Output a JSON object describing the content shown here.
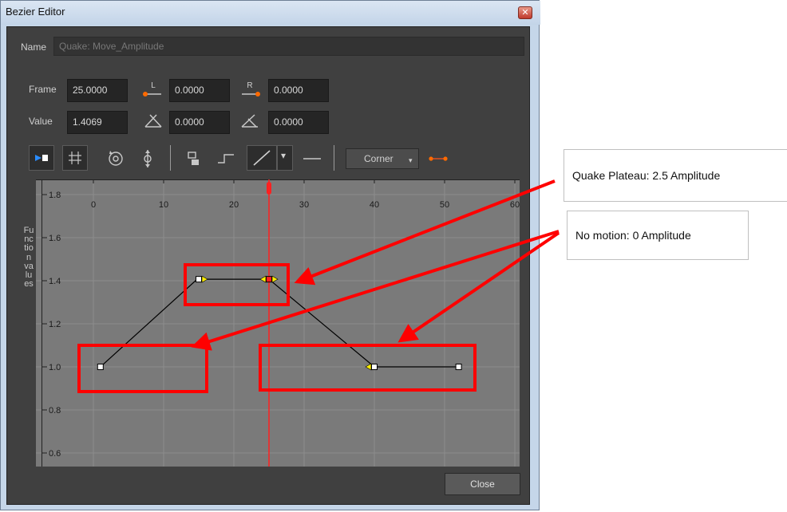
{
  "window": {
    "title": "Bezier Editor",
    "close_glyph": "✕"
  },
  "name_row": {
    "label": "Name",
    "value": "Quake: Move_Amplitude"
  },
  "fields": {
    "frame_label": "Frame",
    "frame_value": "25.0000",
    "left_x_value": "0.0000",
    "right_x_value": "0.0000",
    "value_label": "Value",
    "value_value": "1.4069",
    "left_angle_value": "0.0000",
    "right_angle_value": "0.0000",
    "left_handle_letter": "L",
    "right_handle_letter": "R"
  },
  "toolbar": {
    "interpolation_button": "Corner",
    "dropdown_arrow": "▾"
  },
  "graph": {
    "axis_title": "Function values",
    "x_ticks": [
      "0",
      "10",
      "20",
      "30",
      "40",
      "50",
      "60"
    ],
    "y_ticks": [
      "1.8",
      "1.6",
      "1.4",
      "1.2",
      "1.0",
      "0.8",
      "0.6"
    ],
    "current_frame": 25,
    "keyframes": [
      {
        "frame": 1,
        "value": 1.0
      },
      {
        "frame": 15,
        "value": 1.4069
      },
      {
        "frame": 25,
        "value": 1.4069
      },
      {
        "frame": 40,
        "value": 1.0
      },
      {
        "frame": 52,
        "value": 1.0
      }
    ],
    "colors": {
      "curve": "#000000",
      "playhead": "#ff2020",
      "handle": "#ffee00",
      "key": "#ffffff"
    }
  },
  "footer": {
    "close_label": "Close"
  },
  "annotations": {
    "plateau": "Quake Plateau: 2.5 Amplitude",
    "no_motion": "No motion: 0 Amplitude",
    "highlight_color": "#ff0000"
  }
}
